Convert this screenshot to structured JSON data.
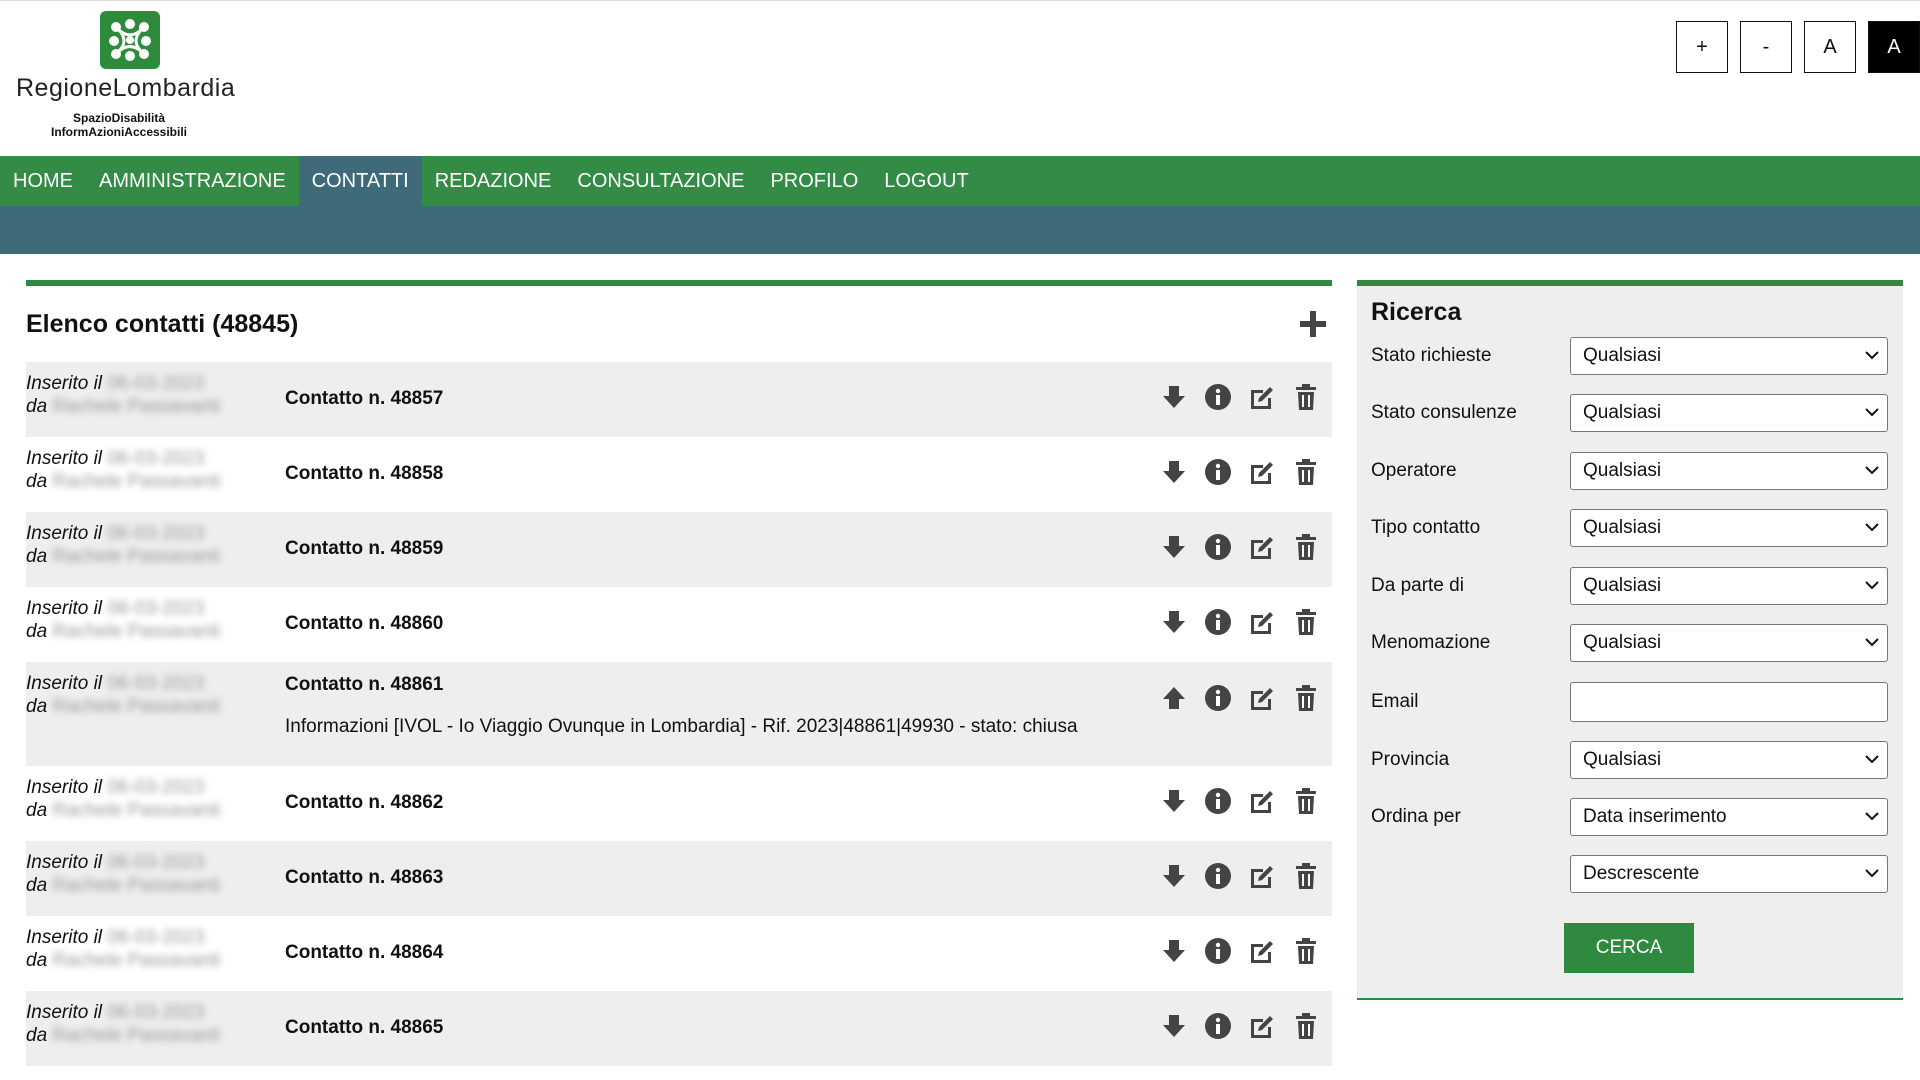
{
  "header": {
    "brand": "RegioneLombardia",
    "subtitle_line1": "SpazioDisabilità",
    "subtitle_line2": "InformAzioniAccessibili",
    "a11y_buttons": [
      "+",
      "-",
      "A",
      "A"
    ]
  },
  "nav": {
    "items": [
      "HOME",
      "AMMINISTRAZIONE",
      "CONTATTI",
      "REDAZIONE",
      "CONSULTAZIONE",
      "PROFILO",
      "LOGOUT"
    ],
    "active": "CONTATTI"
  },
  "main": {
    "title": "Elenco contatti (48845)",
    "meta_inserted_label": "Inserito il",
    "meta_by_label": "da",
    "meta_date_redacted": "06-03-2023",
    "meta_user_redacted": "Rachele Passavanti",
    "rows": [
      {
        "title": "Contatto n. 48857",
        "description": "",
        "toggle": "down",
        "expanded": false
      },
      {
        "title": "Contatto n. 48858",
        "description": "",
        "toggle": "down",
        "expanded": false
      },
      {
        "title": "Contatto n. 48859",
        "description": "",
        "toggle": "down",
        "expanded": false
      },
      {
        "title": "Contatto n. 48860",
        "description": "",
        "toggle": "down",
        "expanded": false
      },
      {
        "title": "Contatto n. 48861",
        "description": "Informazioni [IVOL - Io Viaggio Ovunque in Lombardia] - Rif. 2023|48861|49930 - stato: chiusa",
        "toggle": "up",
        "expanded": true
      },
      {
        "title": "Contatto n. 48862",
        "description": "",
        "toggle": "down",
        "expanded": false
      },
      {
        "title": "Contatto n. 48863",
        "description": "",
        "toggle": "down",
        "expanded": false
      },
      {
        "title": "Contatto n. 48864",
        "description": "",
        "toggle": "down",
        "expanded": false
      },
      {
        "title": "Contatto n. 48865",
        "description": "",
        "toggle": "down",
        "expanded": false
      }
    ]
  },
  "search": {
    "title": "Ricerca",
    "fields": [
      {
        "label": "Stato richieste",
        "value": "Qualsiasi",
        "type": "select"
      },
      {
        "label": "Stato consulenze",
        "value": "Qualsiasi",
        "type": "select"
      },
      {
        "label": "Operatore",
        "value": "Qualsiasi",
        "type": "select"
      },
      {
        "label": "Tipo contatto",
        "value": "Qualsiasi",
        "type": "select"
      },
      {
        "label": "Da parte di",
        "value": "Qualsiasi",
        "type": "select"
      },
      {
        "label": "Menomazione",
        "value": "Qualsiasi",
        "type": "select"
      },
      {
        "label": "Email",
        "value": "",
        "type": "input"
      },
      {
        "label": "Provincia",
        "value": "Qualsiasi",
        "type": "select"
      },
      {
        "label": "Ordina per",
        "value": "Data inserimento",
        "type": "select"
      },
      {
        "label": "",
        "value": "Descrescente",
        "type": "select"
      }
    ],
    "submit_label": "CERCA"
  },
  "colors": {
    "green": "#338b45",
    "steel": "#3f6a7a",
    "row_grey": "#eeeeee"
  }
}
